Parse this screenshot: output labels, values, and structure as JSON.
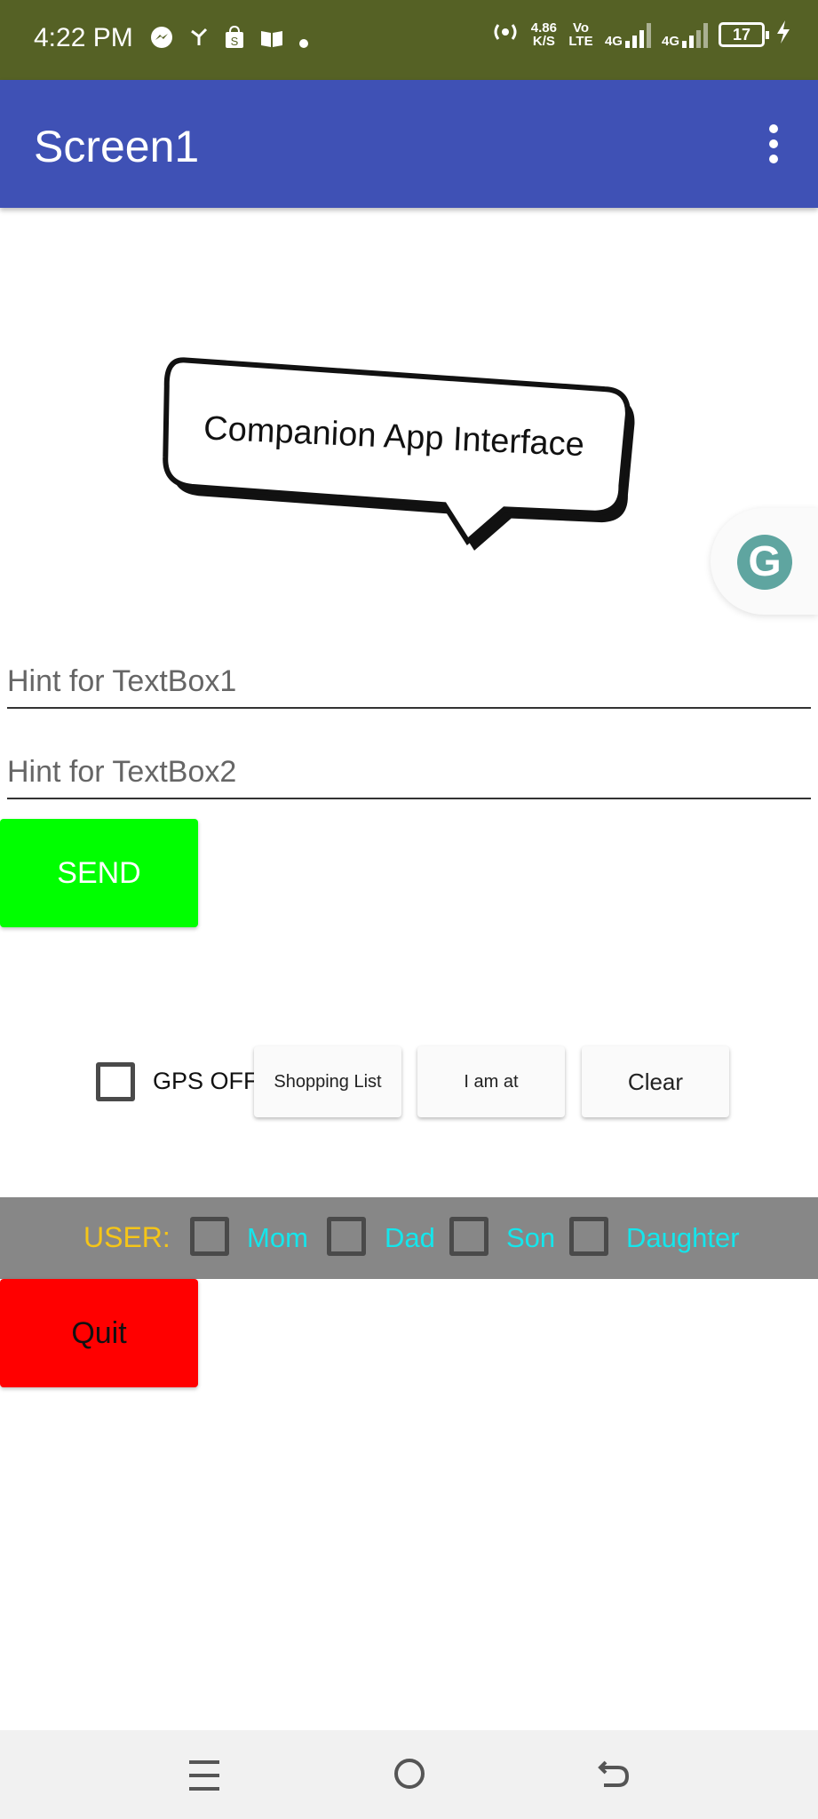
{
  "status_bar": {
    "time": "4:22 PM",
    "speed_value": "4.86",
    "speed_unit": "K/S",
    "volte": "Vo LTE",
    "net1": "4G",
    "net2": "4G",
    "battery_level": "17"
  },
  "app_bar": {
    "title": "Screen1"
  },
  "banner": {
    "text": "Companion App Interface"
  },
  "grammarly": {
    "letter": "G"
  },
  "textbox1": {
    "placeholder": "Hint for TextBox1"
  },
  "textbox2": {
    "placeholder": "Hint for TextBox2"
  },
  "send_button": {
    "label": "SEND"
  },
  "gps": {
    "label": "GPS OFF",
    "checked": false
  },
  "buttons": {
    "shopping_list": "Shopping List",
    "i_am_at": "I am at",
    "clear": "Clear"
  },
  "user_bar": {
    "label": "USER:",
    "options": [
      {
        "label": "Mom",
        "checked": false
      },
      {
        "label": "Dad",
        "checked": false
      },
      {
        "label": "Son",
        "checked": false
      },
      {
        "label": "Daughter",
        "checked": false
      }
    ]
  },
  "quit_button": {
    "label": "Quit"
  },
  "colors": {
    "status_bar": "#556125",
    "app_bar": "#3f51b5",
    "send_button": "#00ff00",
    "quit_button": "#ff0000",
    "user_bar": "#878787",
    "user_label": "#f5c518",
    "user_option_text": "#14e6ec"
  }
}
